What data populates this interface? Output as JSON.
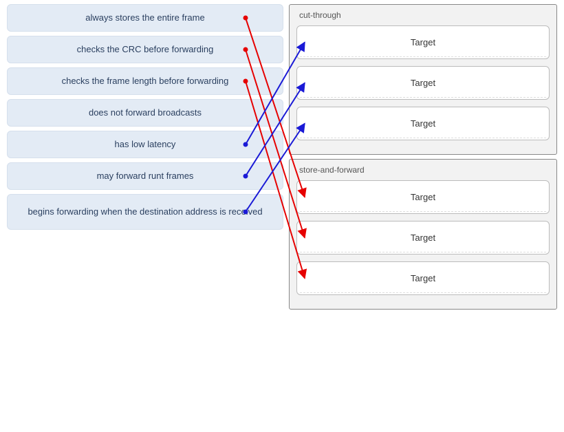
{
  "sources": [
    {
      "label": "always stores the entire frame"
    },
    {
      "label": "checks the CRC before forwarding"
    },
    {
      "label": "checks the frame length before forwarding"
    },
    {
      "label": "does not forward broadcasts"
    },
    {
      "label": "has low latency"
    },
    {
      "label": "may forward runt frames"
    },
    {
      "label": "begins forwarding when the destination address is received"
    }
  ],
  "groups": [
    {
      "name": "cut-through",
      "targets": [
        {
          "label": "Target"
        },
        {
          "label": "Target"
        },
        {
          "label": "Target"
        }
      ]
    },
    {
      "name": "store-and-forward",
      "targets": [
        {
          "label": "Target"
        },
        {
          "label": "Target"
        },
        {
          "label": "Target"
        }
      ]
    }
  ],
  "connections": [
    {
      "from": 0,
      "toGroup": 1,
      "toTarget": 0,
      "color": "red"
    },
    {
      "from": 1,
      "toGroup": 1,
      "toTarget": 1,
      "color": "red"
    },
    {
      "from": 2,
      "toGroup": 1,
      "toTarget": 2,
      "color": "red"
    },
    {
      "from": 4,
      "toGroup": 0,
      "toTarget": 0,
      "color": "blue"
    },
    {
      "from": 5,
      "toGroup": 0,
      "toTarget": 1,
      "color": "blue"
    },
    {
      "from": 6,
      "toGroup": 0,
      "toTarget": 2,
      "color": "blue"
    }
  ],
  "chart_data": {
    "type": "table",
    "title": "Switching methods matching (drag-and-drop)",
    "mapping": {
      "cut-through": [
        "has low latency",
        "may forward runt frames",
        "begins forwarding when the destination address is received"
      ],
      "store-and-forward": [
        "always stores the entire frame",
        "checks the CRC before forwarding",
        "checks the frame length before forwarding"
      ],
      "unmatched": [
        "does not forward broadcasts"
      ]
    }
  }
}
